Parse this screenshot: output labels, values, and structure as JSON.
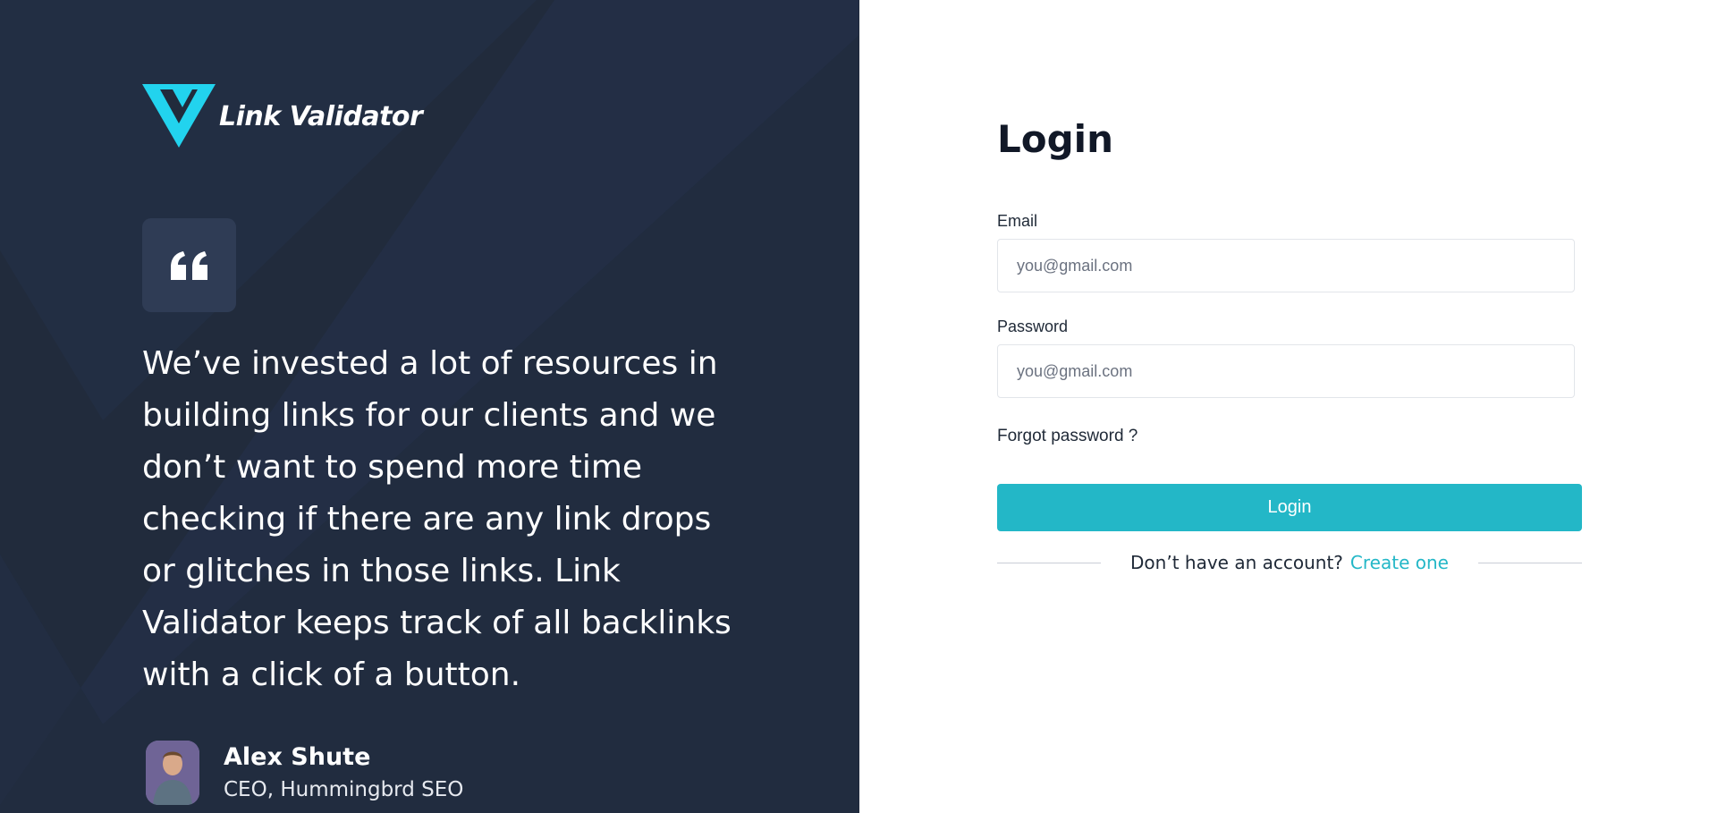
{
  "brand": {
    "name": "Link Validator",
    "logo_icon": "v-logo-icon",
    "logo_color": "#22d3ee"
  },
  "testimonial": {
    "quote_icon": "quote-icon",
    "quote": "We’ve invested a lot of resources in building links for our clients and we don’t want to spend more time checking if there are any link drops or glitches in those links. Link Validator keeps track of all backlinks with a click of a button.",
    "author_name": "Alex Shute",
    "author_role": "CEO, Hummingbrd SEO"
  },
  "login": {
    "title": "Login",
    "email_label": "Email",
    "email_placeholder": "you@gmail.com",
    "password_label": "Password",
    "password_placeholder": "you@gmail.com",
    "forgot_label": "Forgot password ?",
    "submit_label": "Login",
    "no_account_text": "Don’t have an account?",
    "create_link_label": "Create one"
  },
  "colors": {
    "left_panel_bg": "#212b3c",
    "accent": "#23b7c7",
    "quote_box_bg": "#2f3c55"
  }
}
